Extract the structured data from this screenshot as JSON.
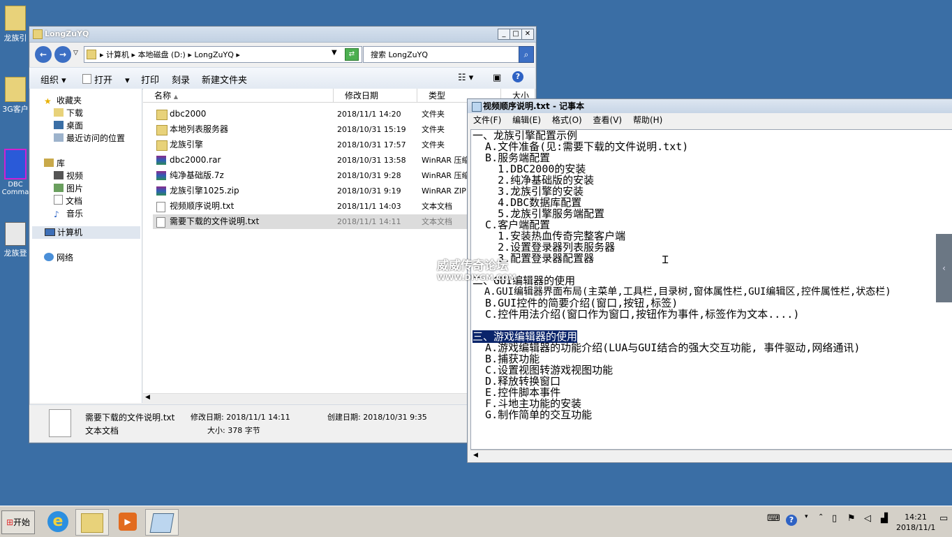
{
  "desktop": {
    "icons": [
      {
        "label": "龙族引"
      },
      {
        "label": "3G客户"
      },
      {
        "label": "DBC Comma"
      },
      {
        "label": "龙族登"
      }
    ]
  },
  "explorer": {
    "title": "LongZuYQ",
    "breadcrumb": [
      "计算机",
      "本地磁盘 (D:)",
      "LongZuYQ"
    ],
    "search_placeholder": "搜索 LongZuYQ",
    "toolbar": {
      "organize": "组织",
      "open": "打开",
      "print": "打印",
      "burn": "刻录",
      "new_folder": "新建文件夹"
    },
    "nav": {
      "favorites": "收藏夹",
      "downloads": "下载",
      "desktop": "桌面",
      "recent": "最近访问的位置",
      "libraries": "库",
      "videos": "视频",
      "pictures": "图片",
      "documents": "文档",
      "music": "音乐",
      "computer": "计算机",
      "network": "网络"
    },
    "columns": {
      "name": "名称",
      "modified": "修改日期",
      "type": "类型",
      "size": "大小"
    },
    "files": [
      {
        "name": "dbc2000",
        "date": "2018/11/1 14:20",
        "type": "文件夹",
        "kind": "folder"
      },
      {
        "name": "本地列表服务器",
        "date": "2018/10/31 15:19",
        "type": "文件夹",
        "kind": "folder"
      },
      {
        "name": "龙族引擎",
        "date": "2018/10/31 17:57",
        "type": "文件夹",
        "kind": "folder"
      },
      {
        "name": "dbc2000.rar",
        "date": "2018/10/31 13:58",
        "type": "WinRAR 压缩",
        "kind": "rar"
      },
      {
        "name": "纯净基础版.7z",
        "date": "2018/10/31 9:28",
        "type": "WinRAR 压缩",
        "kind": "rar"
      },
      {
        "name": "龙族引擎1025.zip",
        "date": "2018/10/31 9:19",
        "type": "WinRAR ZIP",
        "kind": "rar"
      },
      {
        "name": "视频顺序说明.txt",
        "date": "2018/11/1 14:03",
        "type": "文本文档",
        "kind": "txt"
      },
      {
        "name": "需要下载的文件说明.txt",
        "date": "2018/11/1 14:11",
        "type": "文本文档",
        "kind": "txt"
      }
    ],
    "status": {
      "filename": "需要下载的文件说明.txt",
      "modified": "修改日期: 2018/11/1 14:11",
      "created": "创建日期: 2018/10/31 9:35",
      "type": "文本文档",
      "size": "大小: 378 字节"
    }
  },
  "notepad": {
    "title": "视频顺序说明.txt - 记事本",
    "menu": [
      "文件(F)",
      "编辑(E)",
      "格式(O)",
      "查看(V)",
      "帮助(H)"
    ],
    "lines": [
      "一、龙族引擎配置示例",
      "  A.文件准备(见:需要下载的文件说明.txt)",
      "  B.服务端配置",
      "    1.DBC2000的安装",
      "    2.纯净基础版的安装",
      "    3.龙族引擎的安装",
      "    4.DBC数据库配置",
      "    5.龙族引擎服务端配置",
      "  C.客户端配置",
      "    1.安装热血传奇完整客户端",
      "    2.设置登录器列表服务器",
      "    3.配置登录器配置器",
      "",
      "二、GUI编辑器的使用",
      "  A.GUI编辑器界面布局(主菜单,工具栏,目录树,窗体属性栏,GUI编辑区,控件属性栏,状态栏)",
      "  B.GUI控件的简要介绍(窗口,按钮,标签)",
      "  C.控件用法介绍(窗口作为窗口,按钮作为事件,标签作为文本....)",
      "",
      "三、游戏编辑器的使用",
      "  A.游戏编辑器的功能介绍(LUA与GUI结合的强大交互功能, 事件驱动,网络通讯)",
      "  B.捕获功能",
      "  C.设置视图转游戏视图功能",
      "  D.释放转换窗口",
      "  E.控件脚本事件",
      "  F.斗地主功能的安装",
      "  G.制作简单的交互功能"
    ]
  },
  "watermark": {
    "cn": "威威传奇论坛",
    "url": "WWW.DIYGM.COM"
  },
  "taskbar": {
    "start": "开始",
    "time": "14:21",
    "date": "2018/11/1"
  }
}
